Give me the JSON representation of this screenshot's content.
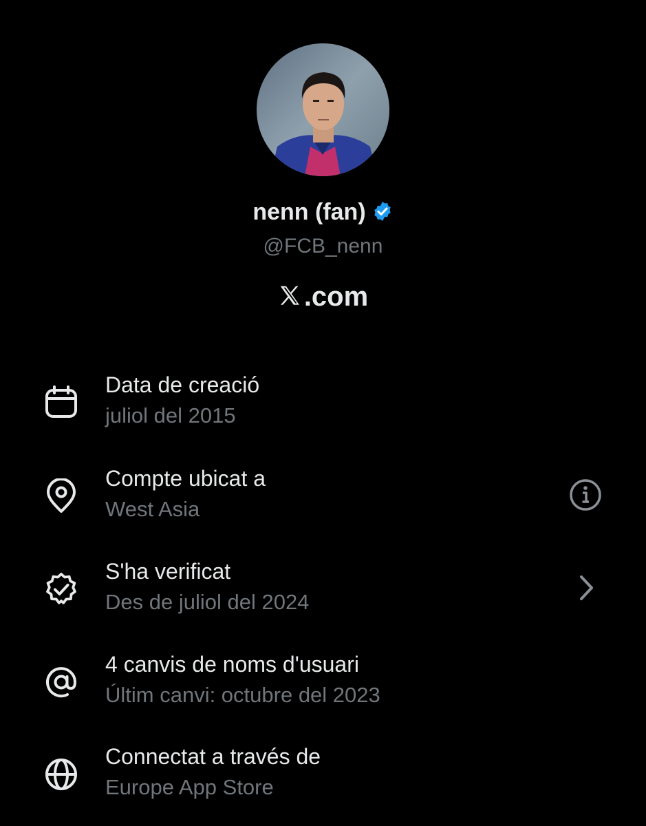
{
  "profile": {
    "display_name": "nenn (fan)",
    "handle": "@FCB_nenn",
    "avatar_alt": "profile photo"
  },
  "brand": {
    "domain_suffix": ".com"
  },
  "colors": {
    "background": "#000000",
    "primary_text": "#e7e9ea",
    "secondary_text": "#71767b",
    "verified_badge": "#1d9bf0"
  },
  "details": [
    {
      "icon": "calendar-icon",
      "title": "Data de creació",
      "subtitle": "juliol del 2015"
    },
    {
      "icon": "location-pin-icon",
      "title": "Compte ubicat a",
      "subtitle": "West Asia",
      "trailing_icon": "info-icon"
    },
    {
      "icon": "verified-badge-icon",
      "title": "S'ha verificat",
      "subtitle": "Des de juliol del 2024",
      "trailing_icon": "chevron-right-icon"
    },
    {
      "icon": "at-sign-icon",
      "title": "4 canvis de noms d'usuari",
      "subtitle": "Últim canvi: octubre del 2023"
    },
    {
      "icon": "globe-icon",
      "title": "Connectat a través de",
      "subtitle": "Europe App Store"
    }
  ]
}
